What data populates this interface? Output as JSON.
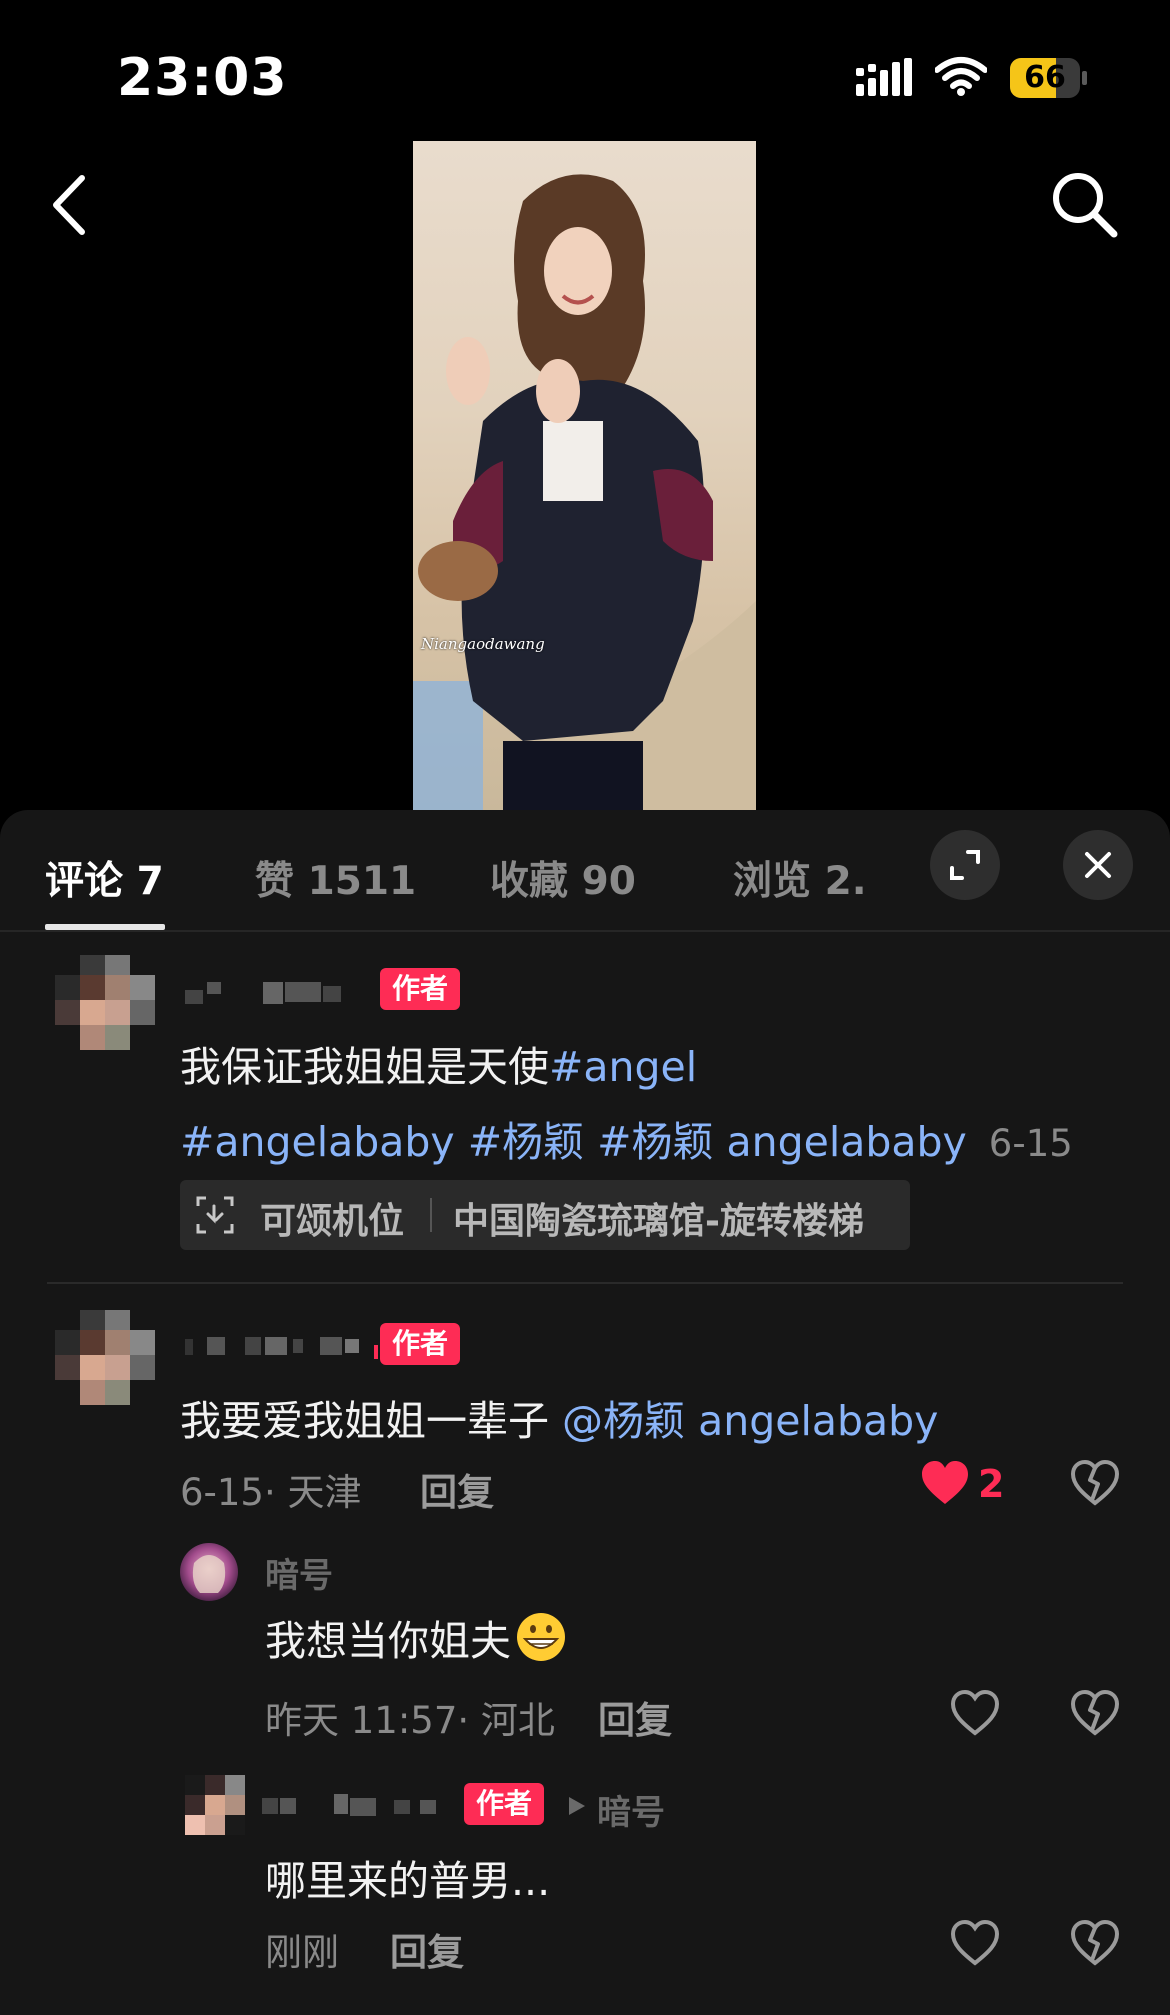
{
  "status_bar": {
    "time": "23:03",
    "battery_percent": "66",
    "battery_level": 0.66,
    "icons": [
      "signal-bars-icon",
      "wifi-icon",
      "battery-icon"
    ]
  },
  "top_nav": {
    "icons": [
      "back-chevron-icon",
      "search-icon"
    ]
  },
  "video": {
    "watermark": "Niangaodawang"
  },
  "sheet": {
    "tabs": [
      {
        "label": "评论 7"
      },
      {
        "label": "赞 1511"
      },
      {
        "label": "收藏 90"
      },
      {
        "label": "浏览 2."
      }
    ],
    "icons": [
      "expand-icon",
      "close-icon"
    ]
  },
  "post": {
    "author_badge": "作者",
    "text_line1_plain": "我保证我姐姐是天使",
    "text_line1_tag": "#angel",
    "text_line2_tags": "#angelababy #杨颖 #杨颖 angelababy",
    "date": "6-15",
    "location_label": "可颂机位",
    "location_place": "中国陶瓷琉璃馆-旋转楼梯"
  },
  "comments": [
    {
      "author_badge": "作者",
      "text_plain": "我要爱我姐姐一辈子 ",
      "mention": "@杨颖 angelababy",
      "meta": "6-15· 天津",
      "reply_label": "回复",
      "like_count": "2",
      "liked": true,
      "icons": [
        "heart-filled-icon",
        "broken-heart-icon"
      ]
    }
  ],
  "replies": [
    {
      "username": "暗号",
      "text": "我想当你姐夫",
      "emoji": "grinning-face-icon",
      "meta": "昨天 11:57· 河北",
      "reply_label": "回复",
      "icons": [
        "heart-outline-icon",
        "broken-heart-icon"
      ]
    },
    {
      "author_badge": "作者",
      "reply_to": "暗号",
      "text": "哪里来的普男...",
      "meta": "刚刚",
      "reply_label": "回复",
      "icons": [
        "heart-outline-icon",
        "broken-heart-icon"
      ]
    }
  ],
  "colors": {
    "accent": "#fe2c55",
    "tag_blue": "#8ab4f8",
    "sheet_bg": "#161616",
    "battery_yellow": "#f5c518"
  }
}
